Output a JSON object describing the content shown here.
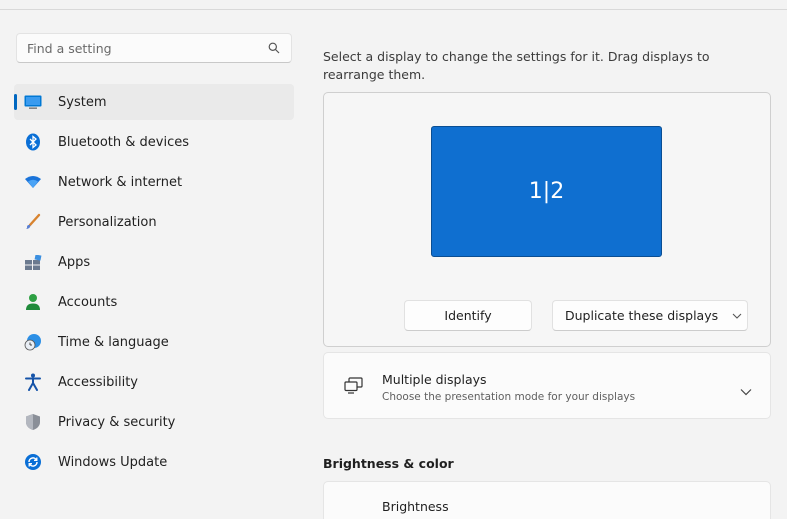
{
  "search": {
    "placeholder": "Find a setting"
  },
  "sidebar": {
    "items": [
      {
        "label": "System",
        "icon": "system-icon",
        "active": true
      },
      {
        "label": "Bluetooth & devices",
        "icon": "bluetooth-icon"
      },
      {
        "label": "Network & internet",
        "icon": "wifi-icon"
      },
      {
        "label": "Personalization",
        "icon": "brush-icon"
      },
      {
        "label": "Apps",
        "icon": "apps-icon"
      },
      {
        "label": "Accounts",
        "icon": "person-icon"
      },
      {
        "label": "Time & language",
        "icon": "globe-clock-icon"
      },
      {
        "label": "Accessibility",
        "icon": "accessibility-icon"
      },
      {
        "label": "Privacy & security",
        "icon": "shield-icon"
      },
      {
        "label": "Windows Update",
        "icon": "update-icon"
      }
    ]
  },
  "main": {
    "description": "Select a display to change the settings for it. Drag displays to rearrange them.",
    "display_label": "1|2",
    "identify_label": "Identify",
    "duplicate_label": "Duplicate these displays",
    "multiple_displays": {
      "title": "Multiple displays",
      "subtitle": "Choose the presentation mode for your displays"
    },
    "brightness_section": "Brightness & color",
    "brightness_title": "Brightness"
  },
  "colors": {
    "accent": "#0067c0",
    "monitor": "#0f6fd0"
  }
}
